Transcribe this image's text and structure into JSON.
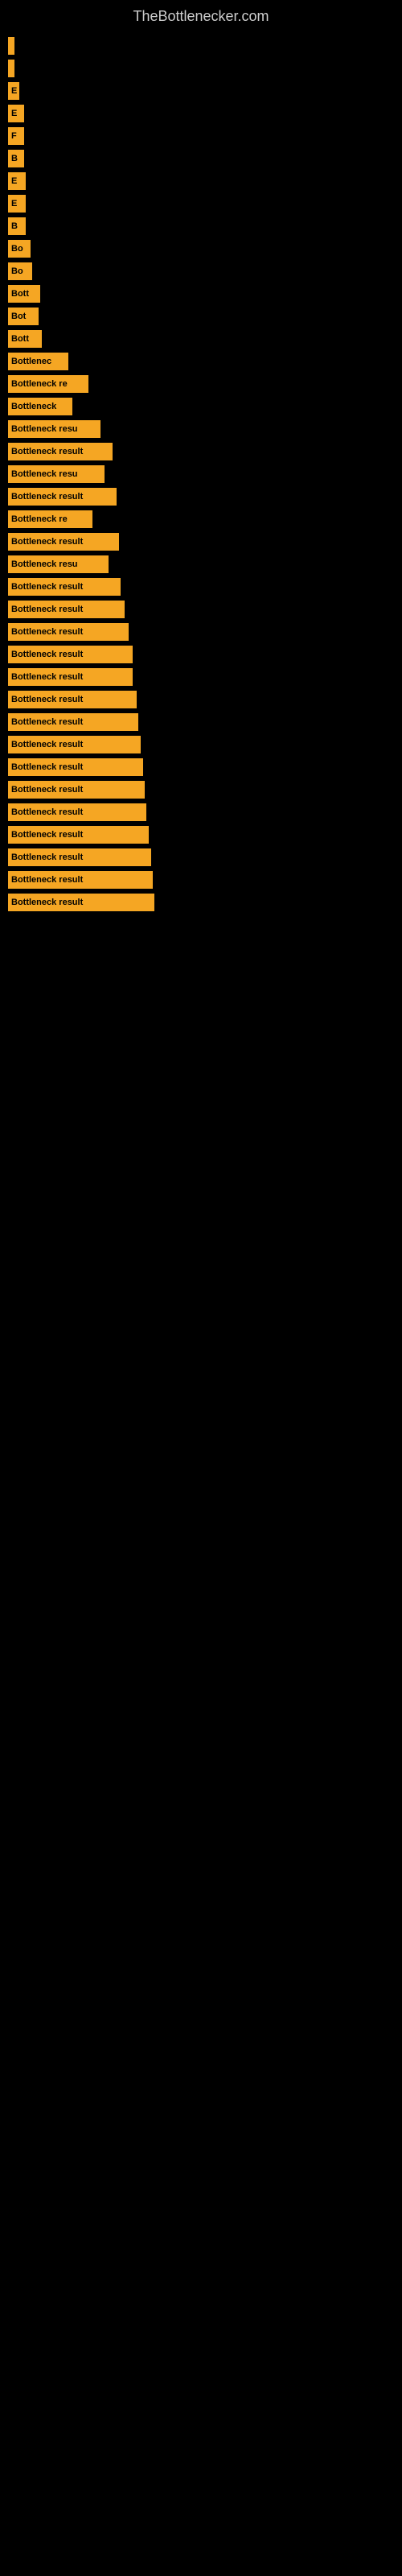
{
  "site": {
    "title": "TheBottlenecker.com"
  },
  "chart": {
    "bars": [
      {
        "id": 1,
        "label": "",
        "width": 8
      },
      {
        "id": 2,
        "label": "",
        "width": 8
      },
      {
        "id": 3,
        "label": "E",
        "width": 14
      },
      {
        "id": 4,
        "label": "E",
        "width": 20
      },
      {
        "id": 5,
        "label": "F",
        "width": 20
      },
      {
        "id": 6,
        "label": "B",
        "width": 20
      },
      {
        "id": 7,
        "label": "E",
        "width": 22
      },
      {
        "id": 8,
        "label": "E",
        "width": 22
      },
      {
        "id": 9,
        "label": "B",
        "width": 22
      },
      {
        "id": 10,
        "label": "Bo",
        "width": 28
      },
      {
        "id": 11,
        "label": "Bo",
        "width": 30
      },
      {
        "id": 12,
        "label": "Bott",
        "width": 40
      },
      {
        "id": 13,
        "label": "Bot",
        "width": 38
      },
      {
        "id": 14,
        "label": "Bott",
        "width": 42
      },
      {
        "id": 15,
        "label": "Bottlenec",
        "width": 75
      },
      {
        "id": 16,
        "label": "Bottleneck re",
        "width": 100
      },
      {
        "id": 17,
        "label": "Bottleneck",
        "width": 80
      },
      {
        "id": 18,
        "label": "Bottleneck resu",
        "width": 115
      },
      {
        "id": 19,
        "label": "Bottleneck result",
        "width": 130
      },
      {
        "id": 20,
        "label": "Bottleneck resu",
        "width": 120
      },
      {
        "id": 21,
        "label": "Bottleneck result",
        "width": 135
      },
      {
        "id": 22,
        "label": "Bottleneck re",
        "width": 105
      },
      {
        "id": 23,
        "label": "Bottleneck result",
        "width": 138
      },
      {
        "id": 24,
        "label": "Bottleneck resu",
        "width": 125
      },
      {
        "id": 25,
        "label": "Bottleneck result",
        "width": 140
      },
      {
        "id": 26,
        "label": "Bottleneck result",
        "width": 145
      },
      {
        "id": 27,
        "label": "Bottleneck result",
        "width": 150
      },
      {
        "id": 28,
        "label": "Bottleneck result",
        "width": 155
      },
      {
        "id": 29,
        "label": "Bottleneck result",
        "width": 155
      },
      {
        "id": 30,
        "label": "Bottleneck result",
        "width": 160
      },
      {
        "id": 31,
        "label": "Bottleneck result",
        "width": 162
      },
      {
        "id": 32,
        "label": "Bottleneck result",
        "width": 165
      },
      {
        "id": 33,
        "label": "Bottleneck result",
        "width": 168
      },
      {
        "id": 34,
        "label": "Bottleneck result",
        "width": 170
      },
      {
        "id": 35,
        "label": "Bottleneck result",
        "width": 172
      },
      {
        "id": 36,
        "label": "Bottleneck result",
        "width": 175
      },
      {
        "id": 37,
        "label": "Bottleneck result",
        "width": 178
      },
      {
        "id": 38,
        "label": "Bottleneck result",
        "width": 180
      },
      {
        "id": 39,
        "label": "Bottleneck result",
        "width": 182
      }
    ]
  }
}
